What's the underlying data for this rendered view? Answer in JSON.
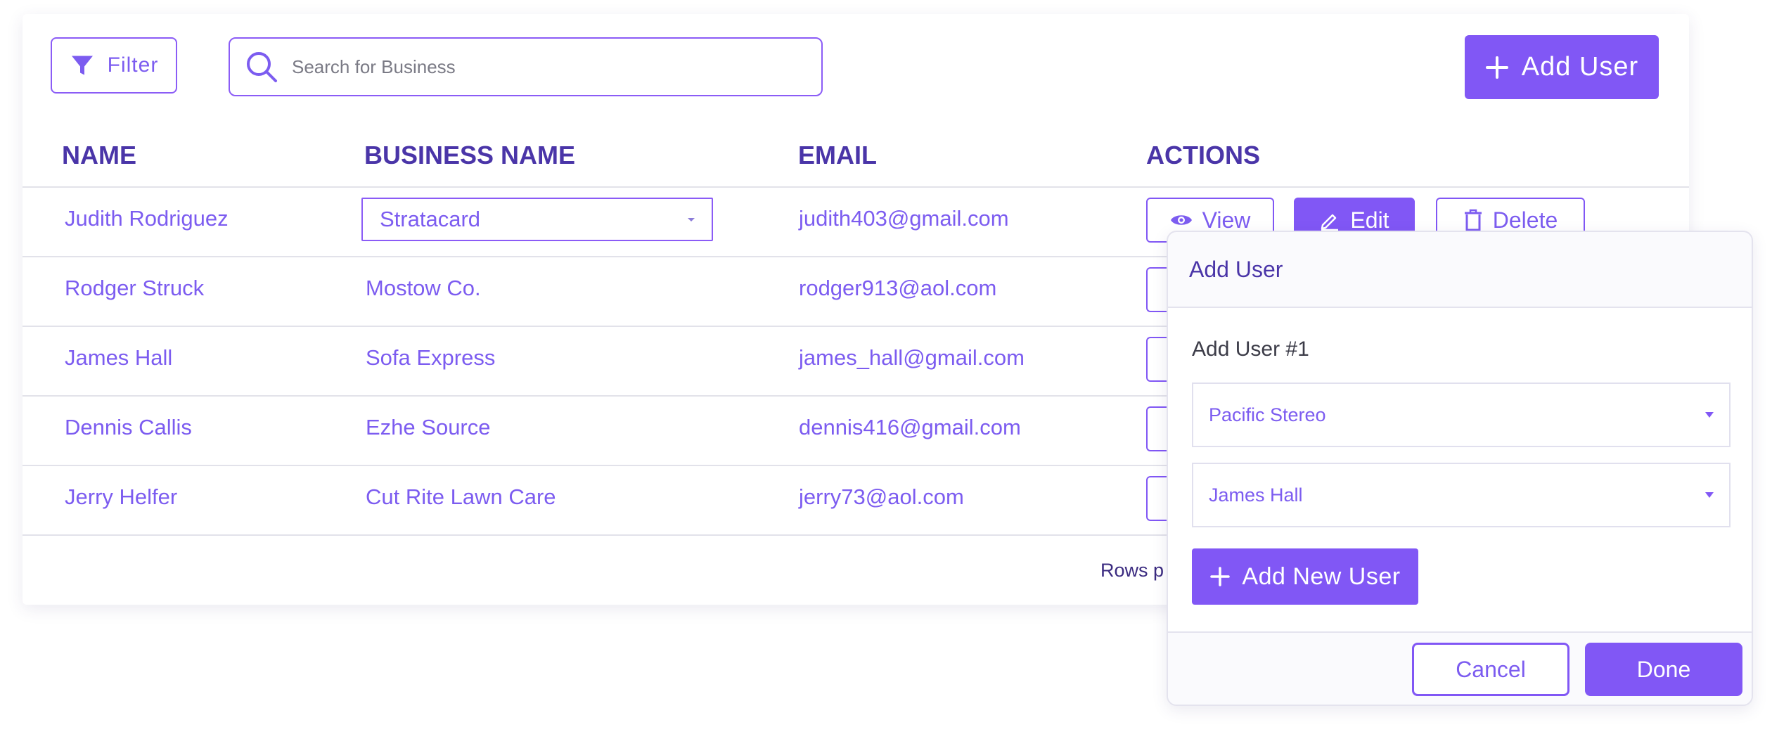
{
  "toolbar": {
    "filter_label": "Filter",
    "filter_icon": "funnel-icon",
    "search_placeholder": "Search for Business",
    "search_icon": "search-icon",
    "add_user_label": "Add User"
  },
  "table": {
    "headers": [
      "NAME",
      "BUSINESS NAME",
      "EMAIL",
      "ACTIONS"
    ],
    "rows": [
      {
        "name": "Judith Rodriguez",
        "business": "Stratacard",
        "email": "judith403@gmail.com"
      },
      {
        "name": "Rodger Struck",
        "business": "Mostow Co.",
        "email": "rodger913@aol.com"
      },
      {
        "name": "James Hall",
        "business": "Sofa Express",
        "email": "james_hall@gmail.com"
      },
      {
        "name": "Dennis Callis",
        "business": "Ezhe Source",
        "email": "dennis416@gmail.com"
      },
      {
        "name": "Jerry Helfer",
        "business": "Cut Rite Lawn Care",
        "email": "jerry73@aol.com"
      }
    ],
    "actions": {
      "view": "View",
      "edit": "Edit",
      "delete": "Delete"
    }
  },
  "footer": {
    "rows_per_page_label": "Rows p"
  },
  "modal": {
    "title": "Add User",
    "subtitle": "Add User #1",
    "business_select": "Pacific Stereo",
    "user_select": "James Hall",
    "add_new_label": "Add New User",
    "cancel_label": "Cancel",
    "done_label": "Done"
  },
  "colors": {
    "accent": "#8157f5",
    "heading": "#4a35a8",
    "text": "#7c5cf0",
    "border": "#e2e2ea"
  }
}
